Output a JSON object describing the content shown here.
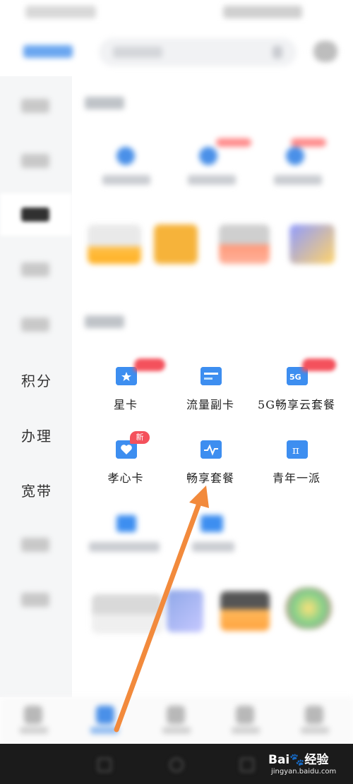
{
  "sidebar": {
    "items": [
      {
        "label": "积分",
        "visible": true
      },
      {
        "label": "办理",
        "visible": true
      },
      {
        "label": "宽带",
        "visible": true
      }
    ]
  },
  "products": [
    {
      "name": "星卡",
      "icon": "star-card-icon",
      "badge": ""
    },
    {
      "name": "流量副卡",
      "icon": "data-card-icon",
      "badge": ""
    },
    {
      "name": "5G畅享云套餐",
      "icon": "5g-cloud-icon",
      "badge": ""
    },
    {
      "name": "孝心卡",
      "icon": "heart-card-icon",
      "badge": "新"
    },
    {
      "name": "畅享套餐",
      "icon": "pulse-card-icon",
      "badge": ""
    },
    {
      "name": "青年一派",
      "icon": "pi-icon",
      "badge": ""
    }
  ],
  "watermark": {
    "brand": "Bai🐾经验",
    "url": "jingyan.baidu.com"
  },
  "colors": {
    "accent_blue": "#3d8ef0",
    "badge_red": "#f4515c",
    "arrow_orange": "#f28a3c"
  }
}
